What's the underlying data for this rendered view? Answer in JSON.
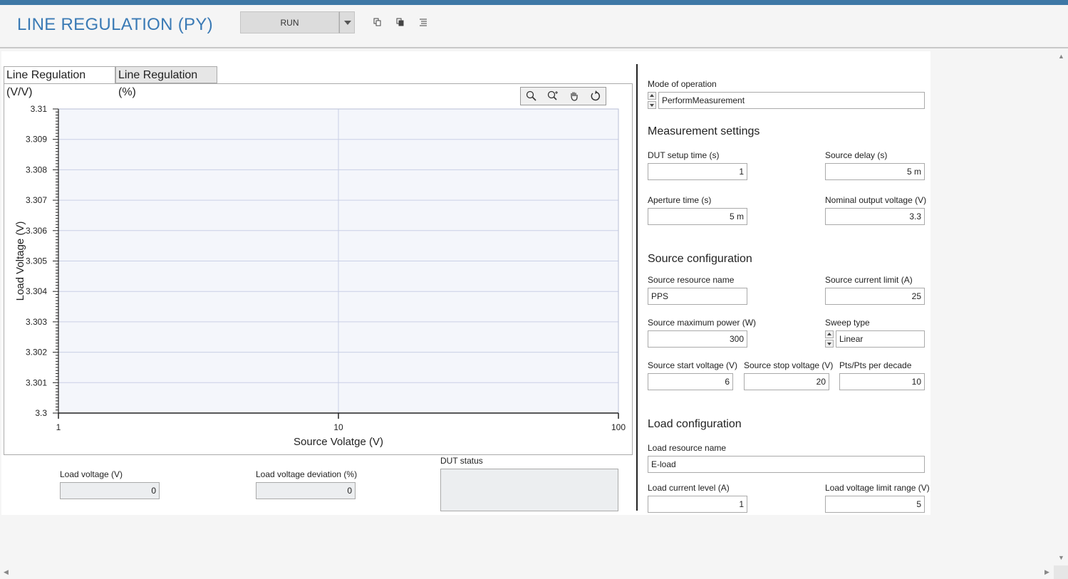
{
  "app": {
    "title": "LINE REGULATION (PY)",
    "run_label": "RUN",
    "accent": "#3e78a6"
  },
  "toolbar": {
    "icons": [
      "copy-icon",
      "paste-icon",
      "list-icon"
    ]
  },
  "tabs": [
    {
      "label": "Line Regulation (V/V)",
      "active": true
    },
    {
      "label": "Line Regulation (%)",
      "active": false
    }
  ],
  "plot": {
    "tools": [
      "zoom-icon",
      "zoom-select-icon",
      "pan-hand-icon",
      "reset-icon"
    ]
  },
  "chart_data": {
    "type": "line",
    "title": "",
    "xlabel": "Source Volatge (V)",
    "ylabel": "Load Voltage (V)",
    "xscale": "log",
    "xlim": [
      1,
      100
    ],
    "ylim": [
      3.3,
      3.31
    ],
    "x_ticks": [
      "1",
      "10",
      "100"
    ],
    "y_ticks": [
      "3.3",
      "3.301",
      "3.302",
      "3.303",
      "3.304",
      "3.305",
      "3.306",
      "3.307",
      "3.308",
      "3.309",
      "3.31"
    ],
    "grid": true,
    "series": []
  },
  "results": {
    "load_voltage_label": "Load voltage (V)",
    "load_voltage_value": "0",
    "deviation_label": "Load voltage deviation (%)",
    "deviation_value": "0",
    "dut_status_label": "DUT status"
  },
  "settings": {
    "mode_label": "Mode of operation",
    "mode_value": "PerformMeasurement",
    "measurement_title": "Measurement settings",
    "dut_setup_label": "DUT setup time (s)",
    "dut_setup_value": "1",
    "source_delay_label": "Source delay (s)",
    "source_delay_value": "5 m",
    "aperture_label": "Aperture time (s)",
    "aperture_value": "5 m",
    "nominal_label": "Nominal output voltage (V)",
    "nominal_value": "3.3",
    "source_title": "Source configuration",
    "source_resource_label": "Source resource name",
    "source_resource_value": "PPS",
    "source_current_label": "Source current limit (A)",
    "source_current_value": "25",
    "source_power_label": "Source maximum power (W)",
    "source_power_value": "300",
    "sweep_label": "Sweep type",
    "sweep_value": "Linear",
    "start_label": "Source start voltage (V)",
    "start_value": "6",
    "stop_label": "Source stop voltage (V)",
    "stop_value": "20",
    "pts_label": "Pts/Pts per decade",
    "pts_value": "10",
    "load_title": "Load configuration",
    "load_resource_label": "Load resource name",
    "load_resource_value": "E-load",
    "load_current_label": "Load current level (A)",
    "load_current_value": "1",
    "load_vlimit_label": "Load voltage limit range (V)",
    "load_vlimit_value": "5"
  }
}
